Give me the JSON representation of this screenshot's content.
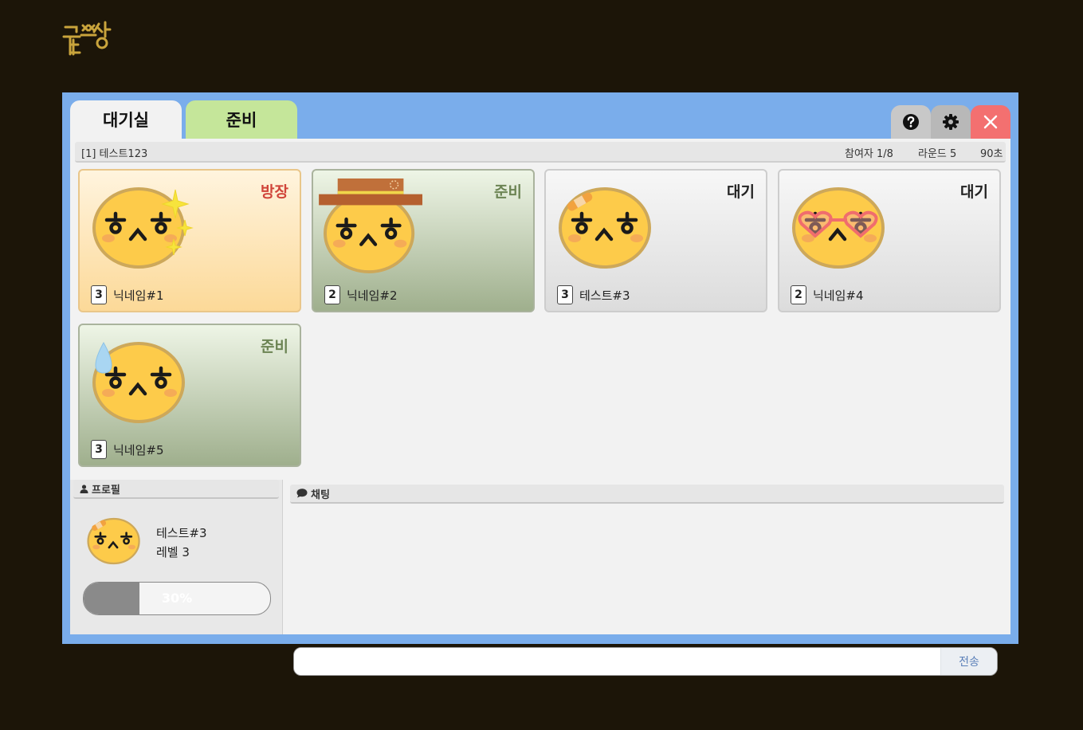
{
  "logo": {
    "text": "끝쪽장"
  },
  "tabs": [
    {
      "label": "대기실"
    },
    {
      "label": "준비"
    }
  ],
  "toolbar": {
    "help_icon": "question-circle-icon",
    "settings_icon": "gear-icon",
    "close_icon": "close-icon"
  },
  "room": {
    "title": "[1] 테스트123",
    "participants": "참여자 1/8",
    "rounds": "라운드 5",
    "time": "90초"
  },
  "players": [
    {
      "nickname": "닉네임#1",
      "level": "3",
      "status": "방장",
      "accessory": "sparkle"
    },
    {
      "nickname": "닉네임#2",
      "level": "2",
      "status": "준비",
      "accessory": "hat"
    },
    {
      "nickname": "테스트#3",
      "level": "3",
      "status": "대기",
      "accessory": "bandage"
    },
    {
      "nickname": "닉네임#4",
      "level": "2",
      "status": "대기",
      "accessory": "heart-glasses"
    },
    {
      "nickname": "닉네임#5",
      "level": "3",
      "status": "준비",
      "accessory": "sweat-drop"
    }
  ],
  "profile": {
    "header": "프로필",
    "name": "테스트#3",
    "level": "레벨 3",
    "exp_label": "30%",
    "exp_progress": 0.3
  },
  "chat": {
    "header": "채팅",
    "input_value": "",
    "send_label": "전송"
  },
  "colors": {
    "window_bg": "#7aadeb",
    "page_bg": "#1c1508",
    "host": "#d0453a",
    "ready": "#6c8454",
    "close": "#f37070",
    "ready_tab": "#c5e69a"
  }
}
